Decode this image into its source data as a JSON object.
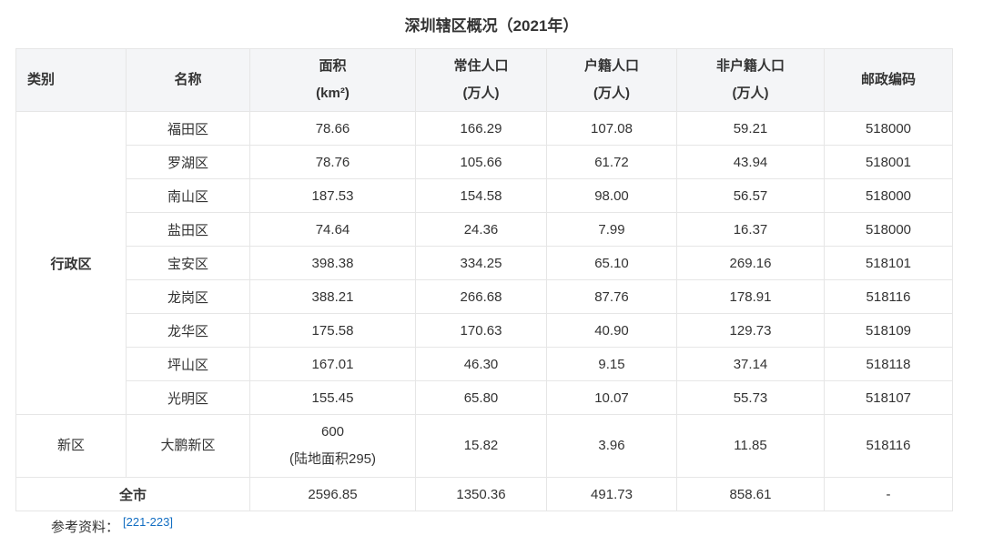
{
  "caption": "深圳辖区概况（2021年）",
  "headers": {
    "category": "类别",
    "name": "名称",
    "area": [
      "面积",
      "(km²)"
    ],
    "resident": [
      "常住人口",
      "(万人)"
    ],
    "registered": [
      "户籍人口",
      "(万人)"
    ],
    "non_registered": [
      "非户籍人口",
      "(万人)"
    ],
    "postal": [
      "邮政编码"
    ]
  },
  "groups": {
    "admin": "行政区",
    "new": "新区",
    "total": "全市"
  },
  "rows": [
    {
      "name": "福田区",
      "area": "78.66",
      "resident": "166.29",
      "registered": "107.08",
      "non_registered": "59.21",
      "postal": "518000"
    },
    {
      "name": "罗湖区",
      "area": "78.76",
      "resident": "105.66",
      "registered": "61.72",
      "non_registered": "43.94",
      "postal": "518001"
    },
    {
      "name": "南山区",
      "area": "187.53",
      "resident": "154.58",
      "registered": "98.00",
      "non_registered": "56.57",
      "postal": "518000"
    },
    {
      "name": "盐田区",
      "area": "74.64",
      "resident": "24.36",
      "registered": "7.99",
      "non_registered": "16.37",
      "postal": "518000"
    },
    {
      "name": "宝安区",
      "area": "398.38",
      "resident": "334.25",
      "registered": "65.10",
      "non_registered": "269.16",
      "postal": "518101"
    },
    {
      "name": "龙岗区",
      "area": "388.21",
      "resident": "266.68",
      "registered": "87.76",
      "non_registered": "178.91",
      "postal": "518116"
    },
    {
      "name": "龙华区",
      "area": "175.58",
      "resident": "170.63",
      "registered": "40.90",
      "non_registered": "129.73",
      "postal": "518109"
    },
    {
      "name": "坪山区",
      "area": "167.01",
      "resident": "46.30",
      "registered": "9.15",
      "non_registered": "37.14",
      "postal": "518118"
    },
    {
      "name": "光明区",
      "area": "155.45",
      "resident": "65.80",
      "registered": "10.07",
      "non_registered": "55.73",
      "postal": "518107"
    }
  ],
  "new_row": {
    "name": "大鹏新区",
    "area": [
      "600",
      "(陆地面积295)"
    ],
    "resident": "15.82",
    "registered": "3.96",
    "non_registered": "11.85",
    "postal": "518116"
  },
  "total_row": {
    "area": "2596.85",
    "resident": "1350.36",
    "registered": "491.73",
    "non_registered": "858.61",
    "postal": "-"
  },
  "reference": {
    "label": "参考资料：",
    "link": "[221-223]"
  }
}
